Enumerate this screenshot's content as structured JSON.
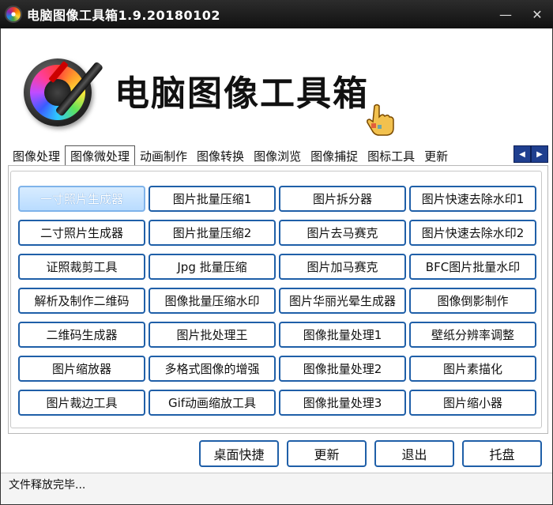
{
  "window": {
    "title": "电脑图像工具箱1.9.20180102",
    "minimize_glyph": "—",
    "close_glyph": "✕"
  },
  "header": {
    "heading": "电脑图像工具箱",
    "logo_icon": "color-dropper-icon",
    "cursor_icon": "pointing-hand-cursor-icon"
  },
  "tabs": {
    "items": [
      {
        "label": "图像处理"
      },
      {
        "label": "图像微处理"
      },
      {
        "label": "动画制作"
      },
      {
        "label": "图像转换"
      },
      {
        "label": "图像浏览"
      },
      {
        "label": "图像捕捉"
      },
      {
        "label": "图标工具"
      },
      {
        "label": "更新"
      }
    ],
    "active_index": 1,
    "scroll_left": "◀",
    "scroll_right": "▶"
  },
  "tools": {
    "items": [
      {
        "label": "一寸照片生成器",
        "selected": true
      },
      {
        "label": "图片批量压缩1"
      },
      {
        "label": "图片拆分器"
      },
      {
        "label": "图片快速去除水印1"
      },
      {
        "label": "二寸照片生成器"
      },
      {
        "label": "图片批量压缩2"
      },
      {
        "label": "图片去马赛克"
      },
      {
        "label": "图片快速去除水印2"
      },
      {
        "label": "证照裁剪工具"
      },
      {
        "label": "Jpg 批量压缩"
      },
      {
        "label": "图片加马赛克"
      },
      {
        "label": "BFC图片批量水印"
      },
      {
        "label": "解析及制作二维码"
      },
      {
        "label": "图像批量压缩水印"
      },
      {
        "label": "图片华丽光晕生成器"
      },
      {
        "label": "图像倒影制作"
      },
      {
        "label": "二维码生成器"
      },
      {
        "label": "图片批处理王"
      },
      {
        "label": "图像批量处理1"
      },
      {
        "label": "壁纸分辨率调整"
      },
      {
        "label": "图片缩放器"
      },
      {
        "label": "多格式图像的增强"
      },
      {
        "label": "图像批量处理2"
      },
      {
        "label": "图片素描化"
      },
      {
        "label": "图片裁边工具"
      },
      {
        "label": "Gif动画缩放工具"
      },
      {
        "label": "图像批量处理3"
      },
      {
        "label": "图片缩小器"
      }
    ]
  },
  "actions": {
    "desktop_shortcut": "桌面快捷",
    "update": "更新",
    "exit": "退出",
    "tray": "托盘"
  },
  "status": {
    "text": "文件释放完毕..."
  }
}
